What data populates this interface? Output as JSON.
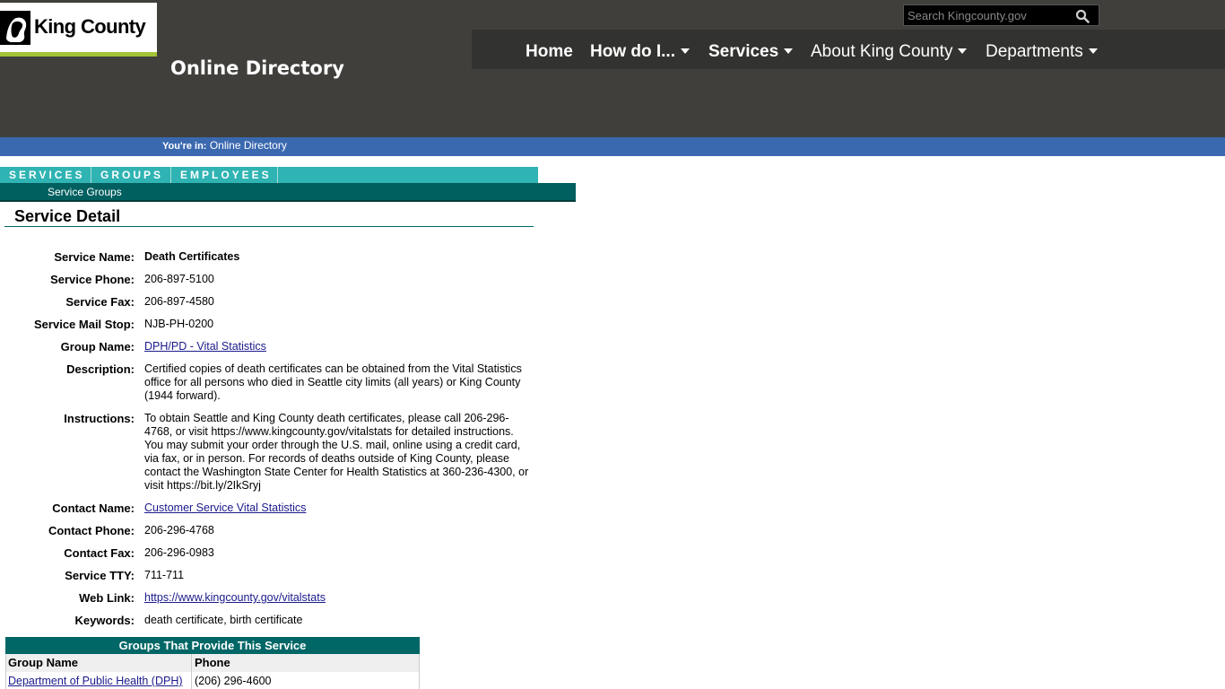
{
  "header": {
    "logo_text": "King County",
    "site_title": "Online Directory",
    "search_placeholder": "Search Kingcounty.gov",
    "nav": [
      {
        "label": "Home",
        "has_caret": false
      },
      {
        "label": "How do I...",
        "has_caret": true
      },
      {
        "label": "Services",
        "has_caret": true
      },
      {
        "label": "About King County",
        "has_caret": true
      },
      {
        "label": "Departments",
        "has_caret": true
      }
    ]
  },
  "breadcrumb": {
    "prefix": "You're in:",
    "current": "Online Directory"
  },
  "tabs": [
    {
      "label": "SERVICES"
    },
    {
      "label": "GROUPS"
    },
    {
      "label": "EMPLOYEES"
    }
  ],
  "subnav": {
    "label": "Service Groups"
  },
  "page_title": "Service Detail",
  "details": [
    {
      "label": "Service Name:",
      "value": "Death Certificates"
    },
    {
      "label": "Service Phone:",
      "value": "206-897-5100"
    },
    {
      "label": "Service Fax:",
      "value": "206-897-4580"
    },
    {
      "label": "Service Mail Stop:",
      "value": "NJB-PH-0200"
    },
    {
      "label": "Group Name:",
      "value": "DPH/PD - Vital Statistics"
    },
    {
      "label": "Description:",
      "value": "Certified copies of death certificates can be obtained from the Vital Statistics office for all persons who died in Seattle city limits (all years) or King County (1944 forward)."
    },
    {
      "label": "Instructions:",
      "value": "To obtain Seattle and King County death certificates, please call 206-296-4768, or visit https://www.kingcounty.gov/vitalstats for detailed instructions. You may submit your order through the U.S. mail, online using a credit card, via fax, or in person. For records of deaths outside of King County, please contact the Washington State Center for Health Statistics at 360-236-4300, or visit https://bit.ly/2IkSryj"
    },
    {
      "label": "Contact Name:",
      "value": "Customer Service Vital Statistics"
    },
    {
      "label": "Contact Phone:",
      "value": "206-296-4768"
    },
    {
      "label": "Contact Fax:",
      "value": "206-296-0983"
    },
    {
      "label": "Service TTY:",
      "value": "711-711"
    },
    {
      "label": "Web Link:",
      "value": "https://www.kingcounty.gov/vitalstats"
    },
    {
      "label": "Keywords:",
      "value": "death certificate, birth certificate"
    }
  ],
  "groups_table": {
    "title": "Groups That Provide This Service",
    "columns": [
      "Group Name",
      "Phone"
    ],
    "rows": [
      {
        "name": "Department of Public Health (DPH)",
        "phone": "(206) 296-4600"
      }
    ]
  },
  "colors": {
    "header_bg": "#403f3c",
    "nav_bg": "#323230",
    "breadcrumb_bg": "#3b69b0",
    "tab_bg": "#2fb3b3",
    "subnav_bg": "#005f5f",
    "logo_accent": "#a2c437",
    "link": "#1a1a8c"
  }
}
